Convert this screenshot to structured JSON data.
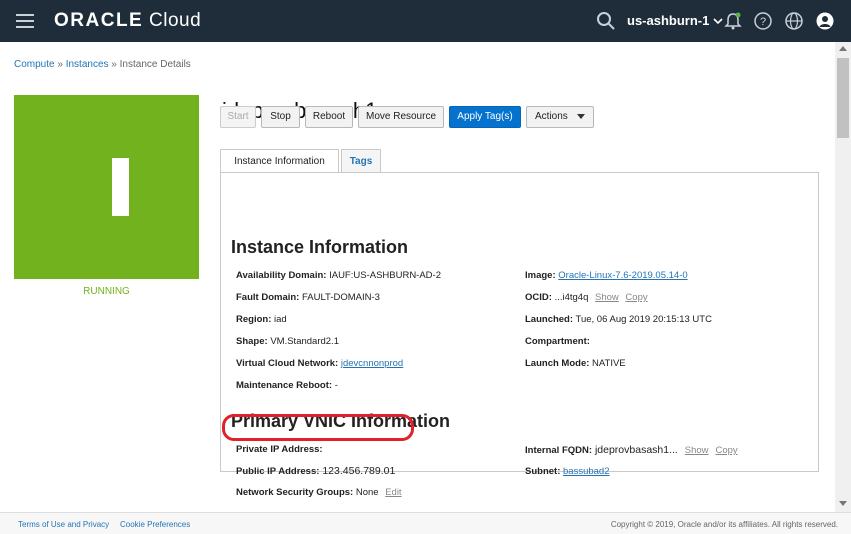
{
  "header": {
    "brand": "ORACLE",
    "product": "Cloud",
    "region": "us-ashburn-1"
  },
  "breadcrumb": {
    "items": [
      "Compute",
      "Instances",
      "Instance Details"
    ],
    "separator": "»"
  },
  "instance": {
    "name": "jdeprovbasash1",
    "status": "RUNNING",
    "status_letter": "I",
    "status_color": "#73b21f"
  },
  "actions": {
    "start": "Start",
    "stop": "Stop",
    "reboot": "Reboot",
    "move": "Move Resource",
    "apply_tags": "Apply Tag(s)",
    "actions_menu": "Actions"
  },
  "tabs": [
    "Instance Information",
    "Tags"
  ],
  "instance_info": {
    "heading": "Instance Information",
    "availability_domain": {
      "label": "Availability Domain:",
      "value": "IAUF:US-ASHBURN-AD-2"
    },
    "fault_domain": {
      "label": "Fault Domain:",
      "value": "FAULT-DOMAIN-3"
    },
    "region": {
      "label": "Region:",
      "value": "iad"
    },
    "shape": {
      "label": "Shape:",
      "value": "VM.Standard2.1"
    },
    "vcn": {
      "label": "Virtual Cloud Network:",
      "value": "jdevcnnonprod"
    },
    "maintenance_reboot": {
      "label": "Maintenance Reboot:",
      "value": "-"
    },
    "image": {
      "label": "Image:",
      "value": "Oracle-Linux-7.6-2019.05.14-0"
    },
    "ocid": {
      "label": "OCID:",
      "value": "...i4tg4q",
      "show": "Show",
      "copy": "Copy"
    },
    "launched": {
      "label": "Launched:",
      "value": "Tue, 06 Aug 2019 20:15:13 UTC"
    },
    "compartment": {
      "label": "Compartment:",
      "value": ""
    },
    "launch_mode": {
      "label": "Launch Mode:",
      "value": "NATIVE"
    }
  },
  "vnic_info": {
    "heading": "Primary VNIC Information",
    "private_ip": {
      "label": "Private IP Address:",
      "value": ""
    },
    "public_ip": {
      "label": "Public IP Address:",
      "value": "123.456.789.01"
    },
    "nsg": {
      "label": "Network Security Groups:",
      "value": "None",
      "edit": "Edit"
    },
    "fqdn": {
      "label": "Internal FQDN:",
      "value": "jdeprovbasash1...",
      "show": "Show",
      "copy": "Copy"
    },
    "subnet": {
      "label": "Subnet:",
      "value": "bassubad2"
    }
  },
  "footer": {
    "terms": "Terms of Use and Privacy",
    "cookies": "Cookie Preferences",
    "copyright": "Copyright © 2019, Oracle and/or its affiliates. All rights reserved."
  },
  "colors": {
    "topbar": "#1f2d3a",
    "primary_button": "#0572ce",
    "link": "#2474b5",
    "callout": "#e0202a"
  }
}
